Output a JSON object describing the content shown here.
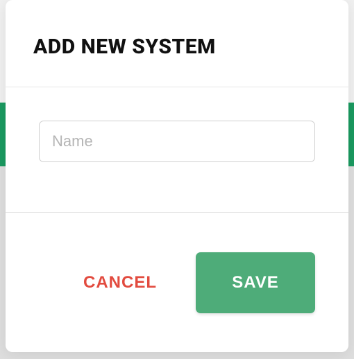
{
  "modal": {
    "title": "ADD NEW SYSTEM",
    "name_placeholder": "Name",
    "name_value": "",
    "cancel_label": "CANCEL",
    "save_label": "SAVE"
  }
}
